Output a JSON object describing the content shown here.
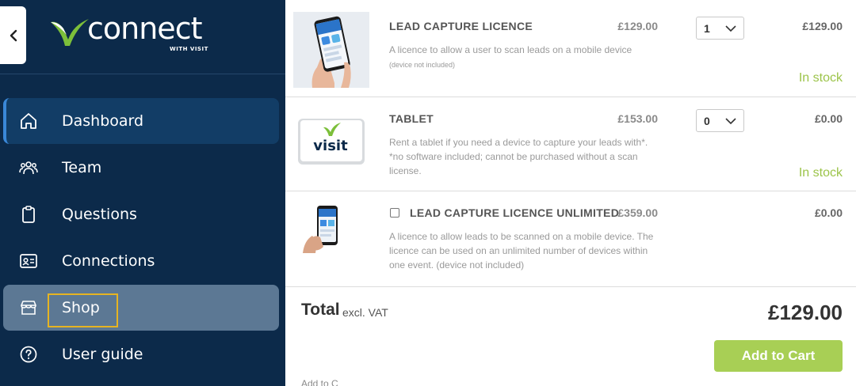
{
  "brand": {
    "name": "connect",
    "tagline": "WITH VISIT",
    "accent": "#7cbf3a",
    "sidebar_bg": "#0c2a4a"
  },
  "sidebar": {
    "items": [
      {
        "label": "Dashboard",
        "icon": "home-icon"
      },
      {
        "label": "Team",
        "icon": "team-icon"
      },
      {
        "label": "Questions",
        "icon": "clipboard-icon"
      },
      {
        "label": "Connections",
        "icon": "contact-card-icon"
      },
      {
        "label": "Shop",
        "icon": "store-icon"
      },
      {
        "label": "User guide",
        "icon": "help-circle-icon"
      }
    ]
  },
  "products": [
    {
      "name": "LEAD CAPTURE LICENCE",
      "price": "£129.00",
      "description": "A licence to allow a user to scan leads on a mobile device",
      "note": "(device not included)",
      "quantity": "1",
      "line_total": "£129.00",
      "stock": "In stock"
    },
    {
      "name": "TABLET",
      "price": "£153.00",
      "description": "Rent a tablet if you need a device to capture your leads with*. *no software included; cannot be purchased without a scan license.",
      "quantity": "0",
      "line_total": "£0.00",
      "stock": "In stock",
      "image_text": "visit"
    },
    {
      "name": "LEAD CAPTURE LICENCE UNLIMITED",
      "price": "£359.00",
      "description": "A licence to allow leads to be scanned on a mobile device. The licence can be used on an unlimited number of devices within one event. (device not included)",
      "line_total": "£0.00"
    }
  ],
  "summary": {
    "total_label": "Total",
    "total_sub": "excl. VAT",
    "total_value": "£129.00",
    "add_to_cart": "Add to Cart",
    "cut_text": "Add to C"
  },
  "colors": {
    "in_stock": "#9cc44a",
    "button": "#a8cf55",
    "highlight": "#e6b422"
  }
}
